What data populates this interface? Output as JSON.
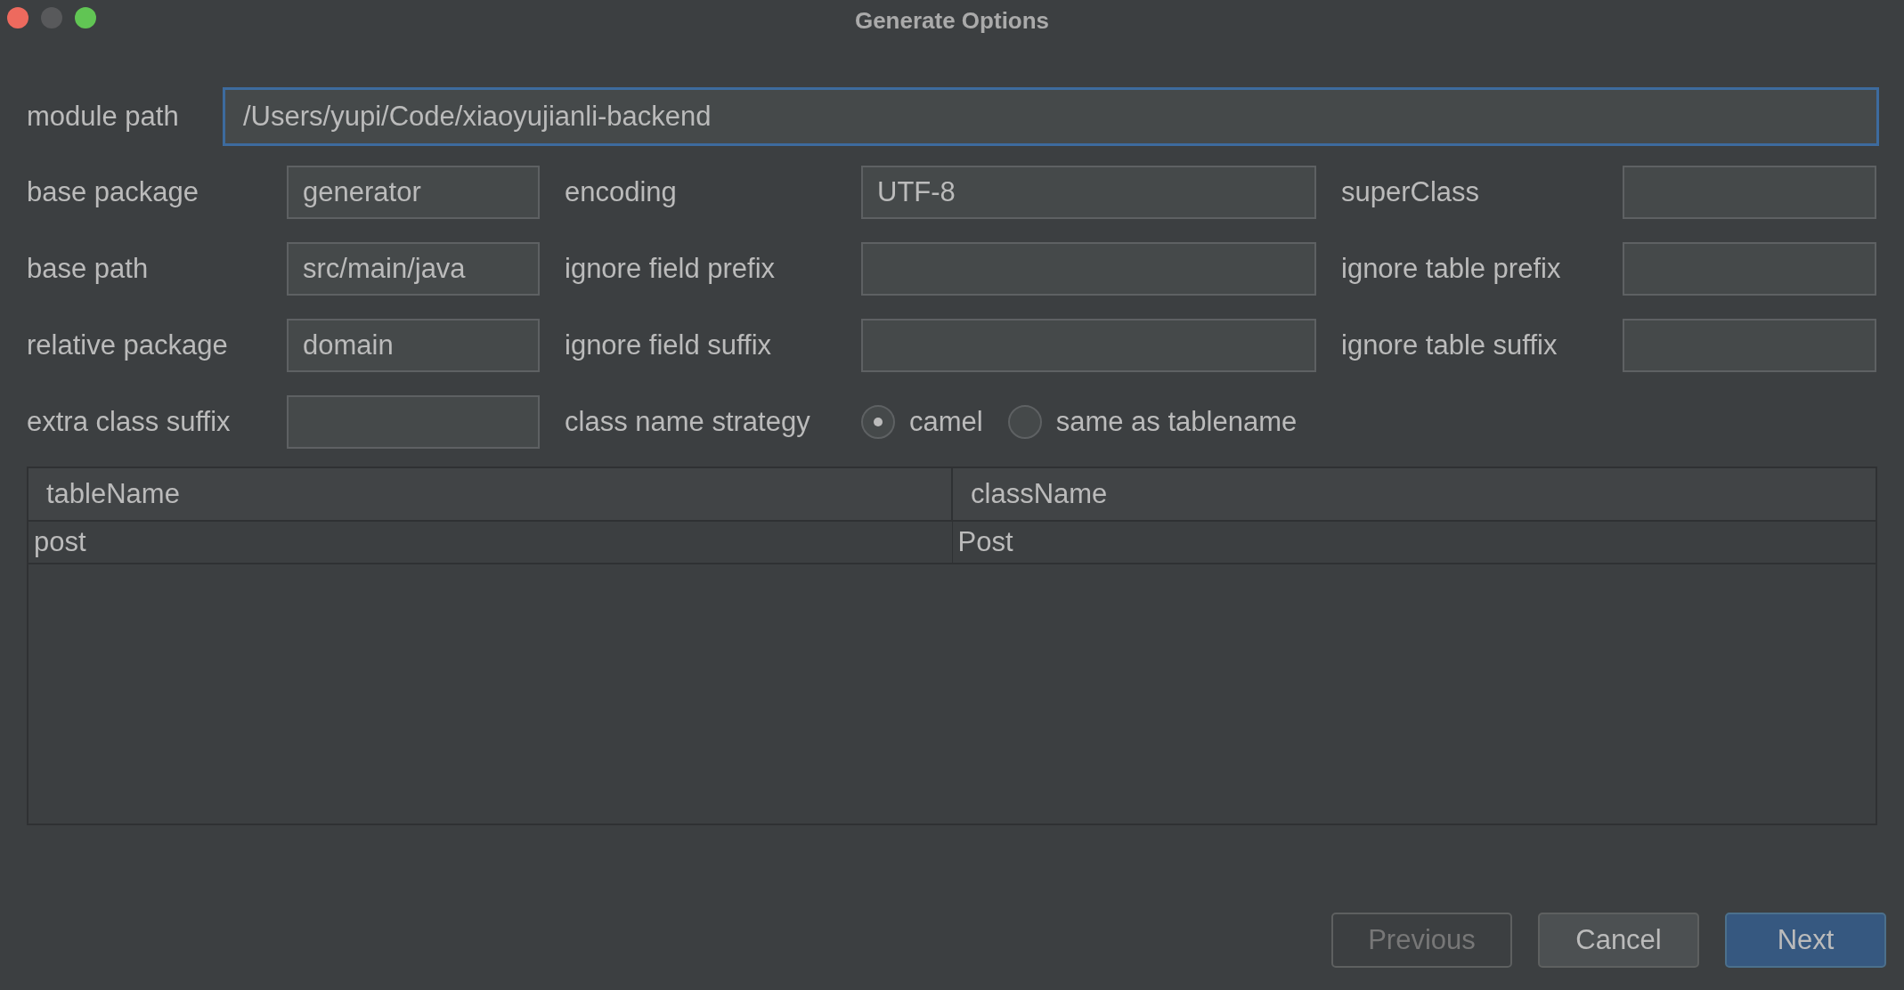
{
  "window": {
    "title": "Generate Options"
  },
  "module_path": {
    "label": "module path",
    "value": "/Users/yupi/Code/xiaoyujianli-backend",
    "focused": true
  },
  "field_rows": [
    [
      {
        "label": "base package",
        "value": "generator"
      },
      {
        "label": "encoding",
        "value": "UTF-8"
      },
      {
        "label": "superClass"
      }
    ],
    [
      {
        "label": "base path",
        "value": "src/main/java"
      },
      {
        "label": "ignore field prefix"
      },
      {
        "label": "ignore table prefix"
      }
    ],
    [
      {
        "label": "relative package",
        "value": "domain"
      },
      {
        "label": "ignore field suffix"
      },
      {
        "label": "ignore table suffix"
      }
    ],
    [
      {
        "label": "extra class suffix"
      }
    ]
  ],
  "class_name_strategy": {
    "label": "class name strategy",
    "options": [
      {
        "label": "camel",
        "selected": true
      },
      {
        "label": "same as tablename",
        "selected": false
      }
    ]
  },
  "table": {
    "columns": [
      "tableName",
      "className"
    ],
    "rows": [
      [
        "post",
        "Post"
      ]
    ]
  },
  "buttons": [
    {
      "label": "Previous",
      "kind": "disabled"
    },
    {
      "label": "Cancel",
      "kind": "default"
    },
    {
      "label": "Next",
      "kind": "primary"
    }
  ]
}
